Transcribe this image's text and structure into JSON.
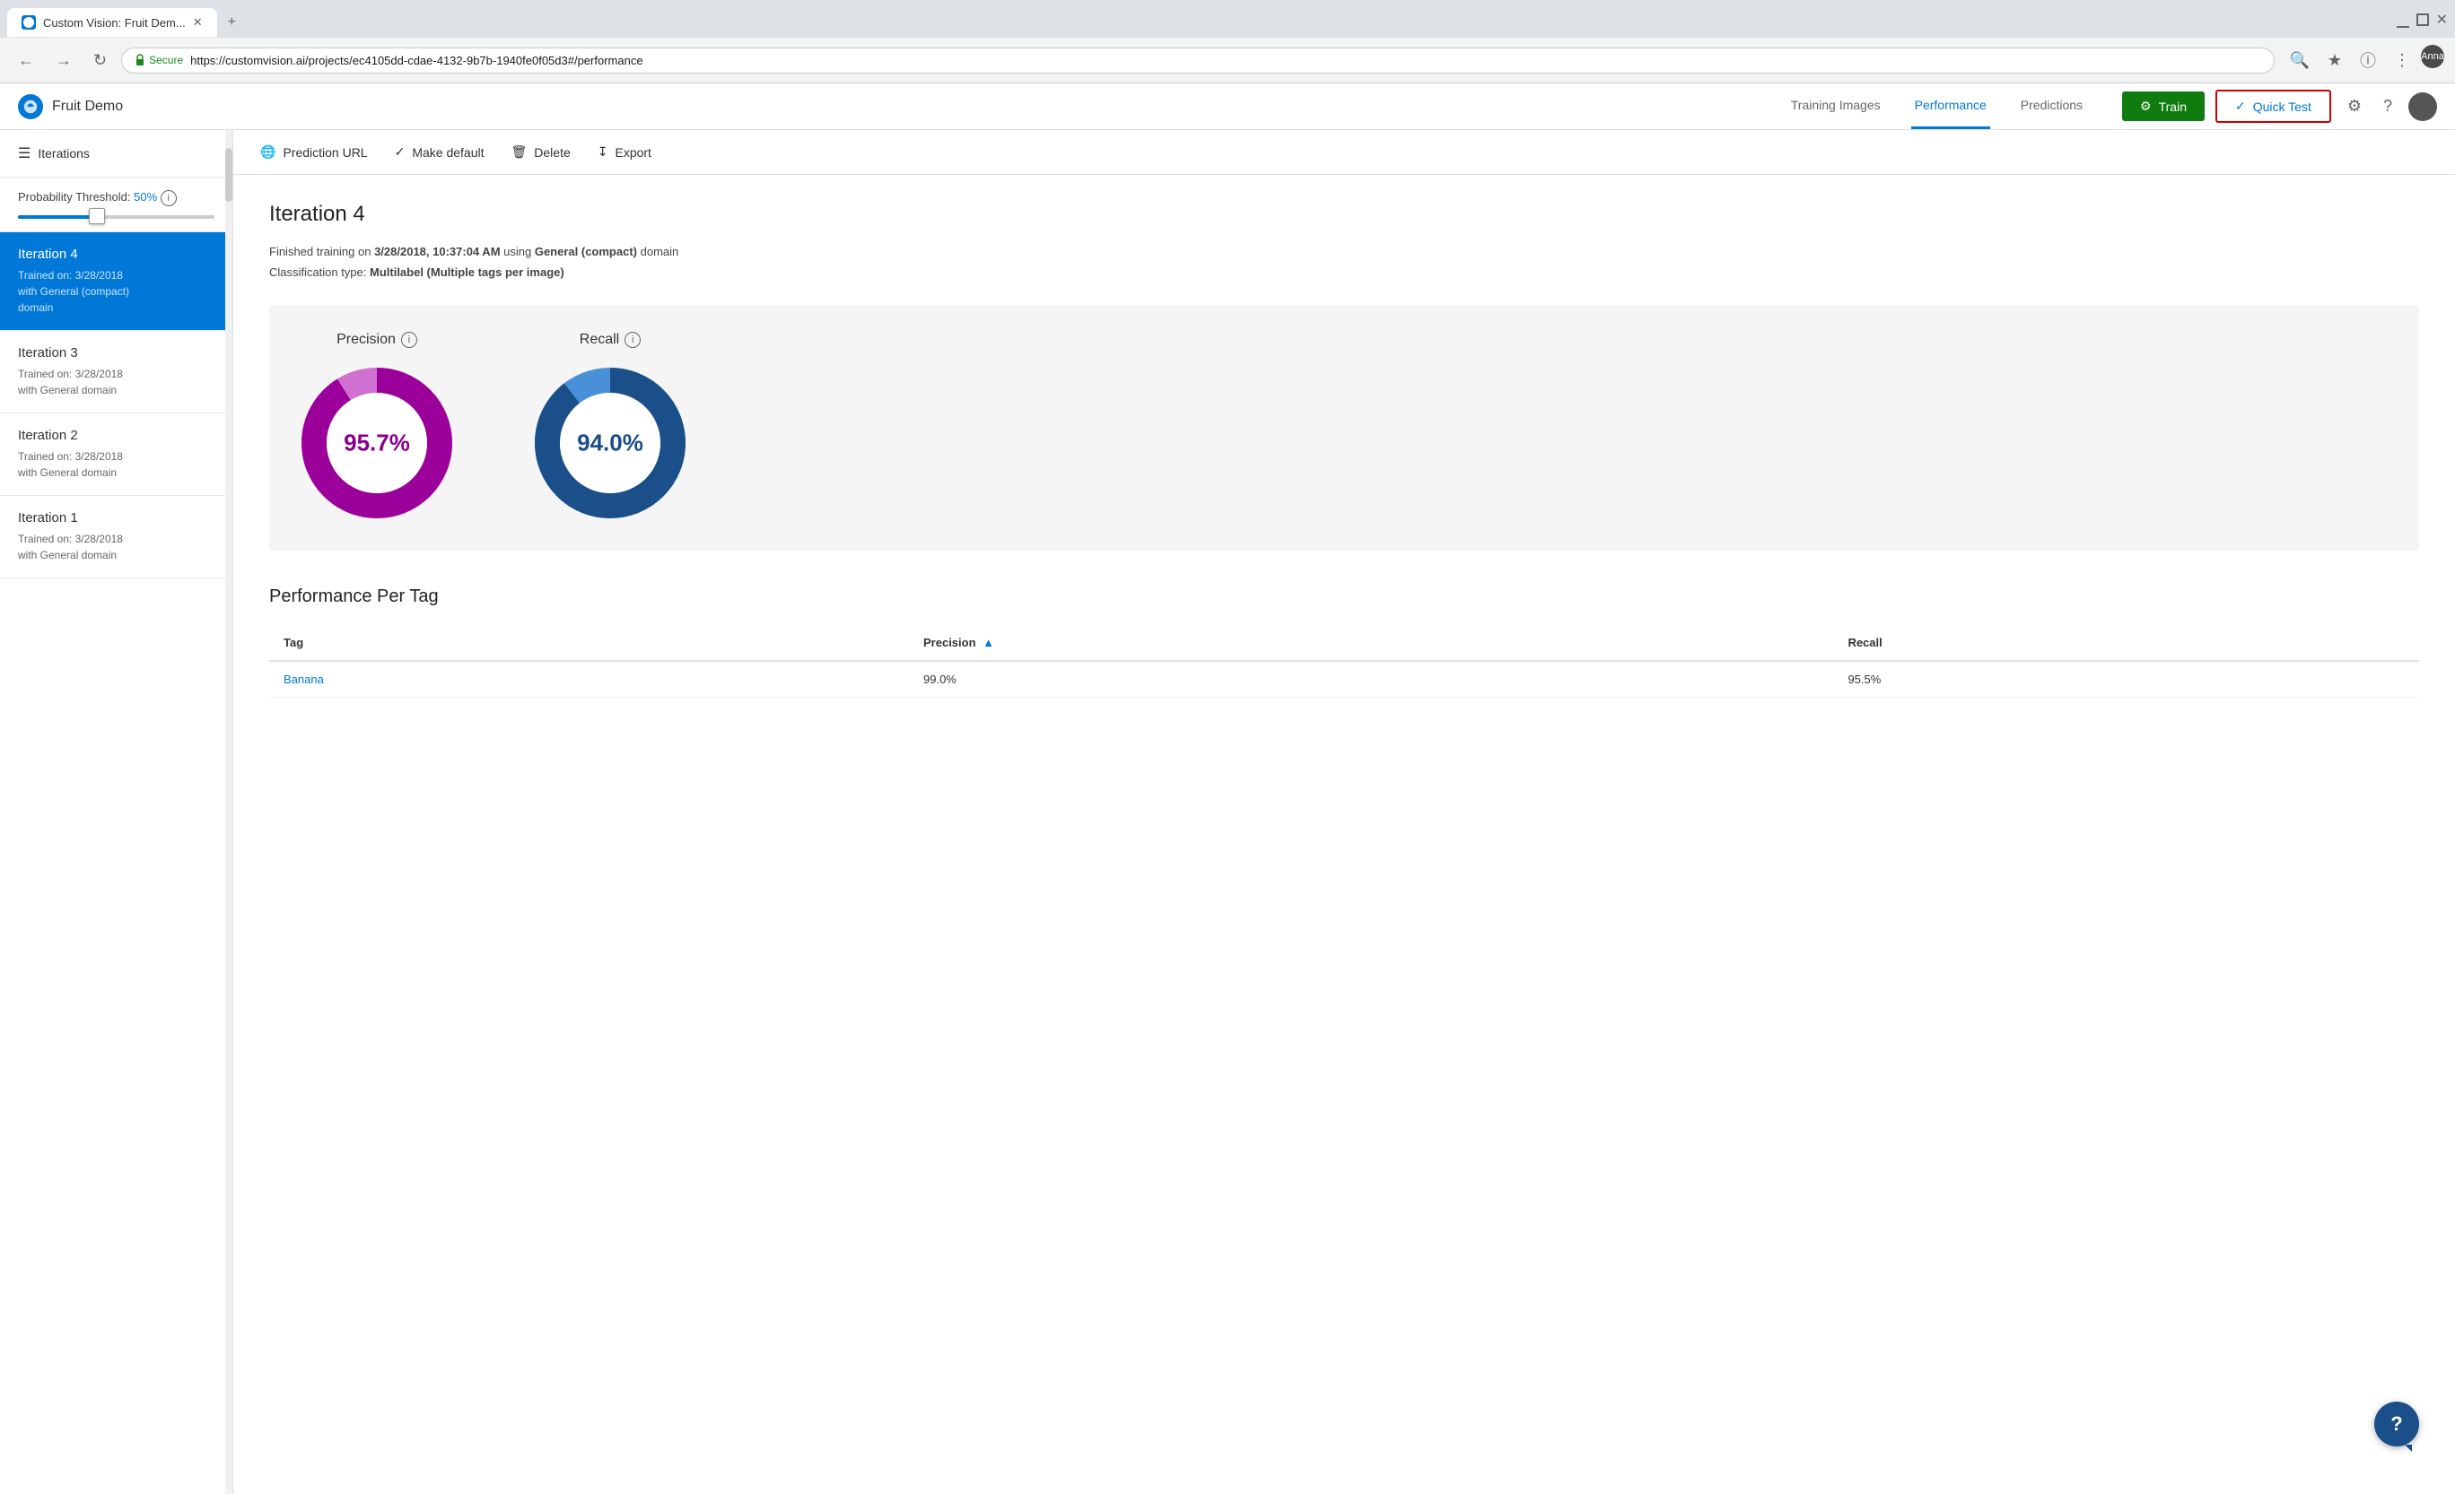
{
  "browser": {
    "tab_title": "Custom Vision: Fruit Dem...",
    "url": "https://customvision.ai/projects/ec4105dd-cdae-4132-9b7b-1940fe0f05d3#/performance",
    "secure_label": "Secure",
    "user_name": "Anna"
  },
  "app": {
    "name": "Fruit Demo",
    "nav": {
      "training_images": "Training Images",
      "performance": "Performance",
      "predictions": "Predictions"
    },
    "buttons": {
      "train": "Train",
      "quick_test": "Quick Test"
    }
  },
  "sidebar": {
    "header": "Iterations",
    "probability_label": "Probability Threshold:",
    "probability_value": "50%",
    "iterations": [
      {
        "title": "Iteration 4",
        "sub": "Trained on: 3/28/2018\nwith General (compact)\ndomain",
        "active": true
      },
      {
        "title": "Iteration 3",
        "sub": "Trained on: 3/28/2018\nwith General domain",
        "active": false
      },
      {
        "title": "Iteration 2",
        "sub": "Trained on: 3/28/2018\nwith General domain",
        "active": false
      },
      {
        "title": "Iteration 1",
        "sub": "Trained on: 3/28/2018\nwith General domain",
        "active": false
      }
    ]
  },
  "toolbar": {
    "prediction_url": "Prediction URL",
    "make_default": "Make default",
    "delete": "Delete",
    "export": "Export"
  },
  "content": {
    "page_title": "Iteration 4",
    "info_line1_prefix": "Finished training on ",
    "info_line1_date": "3/28/2018, 10:37:04 AM",
    "info_line1_suffix": " using ",
    "info_line1_domain": "General (compact)",
    "info_line1_end": " domain",
    "info_line2_prefix": "Classification type: ",
    "info_line2_type": "Multilabel (Multiple tags per image)"
  },
  "precision_chart": {
    "title": "Precision",
    "value": "95.7%",
    "percentage": 95.7,
    "color": "#9b009b",
    "bg_color": "#d070d0"
  },
  "recall_chart": {
    "title": "Recall",
    "value": "94.0%",
    "percentage": 94.0,
    "color": "#1a4f8a",
    "bg_color": "#4a90d9"
  },
  "performance_per_tag": {
    "title": "Performance Per Tag",
    "columns": {
      "tag": "Tag",
      "precision": "Precision",
      "recall": "Recall"
    },
    "rows": [
      {
        "tag": "Banana",
        "precision": "99.0%",
        "recall": "95.5%"
      }
    ]
  },
  "help": {
    "label": "?"
  }
}
